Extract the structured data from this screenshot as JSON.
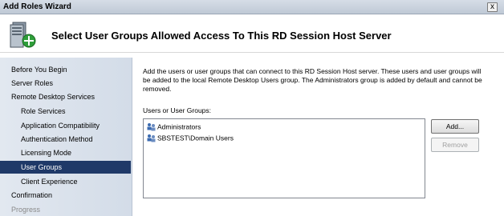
{
  "window": {
    "title": "Add Roles Wizard",
    "close_label": "x"
  },
  "header": {
    "title": "Select User Groups Allowed Access To This RD Session Host Server",
    "icon": "server-add-icon"
  },
  "nav": {
    "items": [
      {
        "label": "Before You Begin",
        "level": 1,
        "state": "normal"
      },
      {
        "label": "Server Roles",
        "level": 1,
        "state": "normal"
      },
      {
        "label": "Remote Desktop Services",
        "level": 1,
        "state": "normal"
      },
      {
        "label": "Role Services",
        "level": 2,
        "state": "normal"
      },
      {
        "label": "Application Compatibility",
        "level": 2,
        "state": "normal"
      },
      {
        "label": "Authentication Method",
        "level": 2,
        "state": "normal"
      },
      {
        "label": "Licensing Mode",
        "level": 2,
        "state": "normal"
      },
      {
        "label": "User Groups",
        "level": 2,
        "state": "selected"
      },
      {
        "label": "Client Experience",
        "level": 2,
        "state": "normal"
      },
      {
        "label": "Confirmation",
        "level": 1,
        "state": "normal"
      },
      {
        "label": "Progress",
        "level": 1,
        "state": "disabled"
      }
    ]
  },
  "main": {
    "description": "Add the users or user groups that can connect to this RD Session Host server. These users and user groups will be added to the local Remote Desktop Users group. The Administrators group is added by default and cannot be removed.",
    "list_label": "Users or User Groups:",
    "groups": [
      {
        "name": "Administrators",
        "icon": "user-group-icon"
      },
      {
        "name": "SBSTEST\\Domain Users",
        "icon": "user-group-icon"
      }
    ],
    "add_button": "Add...",
    "remove_button": "Remove"
  },
  "colors": {
    "selected_nav_bg": "#1f3968",
    "nav_bg": "#dbe2ec"
  }
}
